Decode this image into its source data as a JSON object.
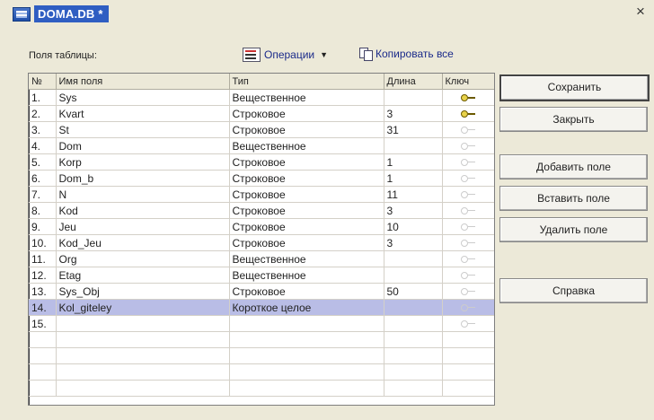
{
  "window": {
    "title": "DOMA.DB *",
    "close_label": "×"
  },
  "toolbar": {
    "fields_label": "Поля таблицы:",
    "operations_label": "Операции",
    "copy_all_label": "Копировать все"
  },
  "table": {
    "headers": [
      "№",
      "Имя поля",
      "Тип",
      "Длина",
      "Ключ"
    ],
    "rows": [
      {
        "num": "1.",
        "name": "Sys",
        "type": "Вещественное",
        "len": "",
        "key": true
      },
      {
        "num": "2.",
        "name": "Kvart",
        "type": "Строковое",
        "len": "3",
        "key": true
      },
      {
        "num": "3.",
        "name": "St",
        "type": "Строковое",
        "len": "31",
        "key": false
      },
      {
        "num": "4.",
        "name": "Dom",
        "type": "Вещественное",
        "len": "",
        "key": false
      },
      {
        "num": "5.",
        "name": "Korp",
        "type": "Строковое",
        "len": "1",
        "key": false
      },
      {
        "num": "6.",
        "name": "Dom_b",
        "type": "Строковое",
        "len": "1",
        "key": false
      },
      {
        "num": "7.",
        "name": "N",
        "type": "Строковое",
        "len": "11",
        "key": false
      },
      {
        "num": "8.",
        "name": "Kod",
        "type": "Строковое",
        "len": "3",
        "key": false
      },
      {
        "num": "9.",
        "name": "Jeu",
        "type": "Строковое",
        "len": "10",
        "key": false
      },
      {
        "num": "10.",
        "name": "Kod_Jeu",
        "type": "Строковое",
        "len": "3",
        "key": false
      },
      {
        "num": "11.",
        "name": "Org",
        "type": "Вещественное",
        "len": "",
        "key": false
      },
      {
        "num": "12.",
        "name": "Etag",
        "type": "Вещественное",
        "len": "",
        "key": false
      },
      {
        "num": "13.",
        "name": "Sys_Obj",
        "type": "Строковое",
        "len": "50",
        "key": false
      },
      {
        "num": "14.",
        "name": "Kol_giteley",
        "type": "Короткое целое",
        "len": "",
        "key": false,
        "selected": true
      },
      {
        "num": "15.",
        "name": "",
        "type": "",
        "len": "",
        "key": false
      }
    ]
  },
  "buttons": {
    "save": "Сохранить",
    "close": "Закрыть",
    "add_field": "Добавить поле",
    "insert_field": "Вставить поле",
    "delete_field": "Удалить поле",
    "help": "Справка"
  }
}
